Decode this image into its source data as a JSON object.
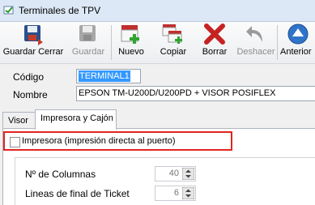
{
  "window": {
    "title": "Terminales de TPV"
  },
  "toolbar": {
    "buttons": [
      {
        "label": "Guardar Cerrar",
        "icon": "save-close-icon"
      },
      {
        "label": "Guardar",
        "icon": "save-icon",
        "disabled": true
      },
      {
        "label": "Nuevo",
        "icon": "new-icon"
      },
      {
        "label": "Copiar",
        "icon": "copy-icon"
      },
      {
        "label": "Borrar",
        "icon": "delete-icon"
      },
      {
        "label": "Deshacer",
        "icon": "undo-icon",
        "disabled": true
      },
      {
        "label": "Anterior",
        "icon": "previous-icon"
      }
    ]
  },
  "form": {
    "code_label": "Código",
    "code_value": "TERMINAL1",
    "name_label": "Nombre",
    "name_value": "EPSON TM-U200D/U200PD  + VISOR POSIFLEX"
  },
  "tabs": [
    {
      "label": "Visor",
      "active": false
    },
    {
      "label": "Impresora y Cajón",
      "active": true
    }
  ],
  "printer": {
    "checkbox_label": "Impresora (impresión directa al puerto)",
    "checked": false,
    "columns_label": "Nº de Columnas",
    "columns_value": "40",
    "ticket_lines_label": "Lineas de final de Ticket",
    "ticket_lines_value": "6"
  },
  "colors": {
    "highlight": "#e0261e",
    "selection": "#3399ff",
    "titlebar": "#dce8f5"
  }
}
